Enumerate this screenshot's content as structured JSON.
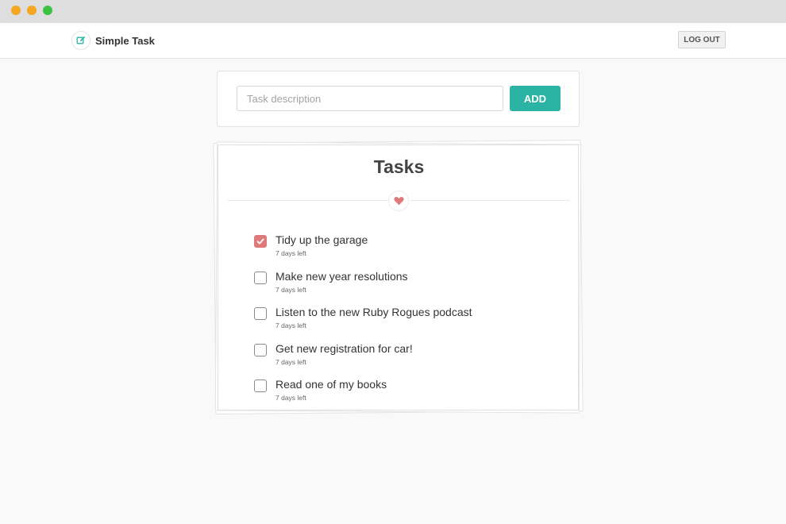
{
  "window": {
    "controls": [
      "close",
      "minimize",
      "maximize"
    ]
  },
  "navbar": {
    "brand_icon": "edit-pencil-icon",
    "brand_name": "Simple Task",
    "logout_label": "LOG OUT"
  },
  "add_form": {
    "placeholder": "Task description",
    "value": "",
    "add_label": "ADD"
  },
  "tasks_card": {
    "title": "Tasks",
    "divider_icon": "heart-icon"
  },
  "tasks": [
    {
      "label": "Tidy up the garage",
      "meta": "7 days left",
      "done": true
    },
    {
      "label": "Make new year resolutions",
      "meta": "7 days left",
      "done": false
    },
    {
      "label": "Listen to the new Ruby Rogues podcast",
      "meta": "7 days left",
      "done": false
    },
    {
      "label": "Get new registration for car!",
      "meta": "7 days left",
      "done": false
    },
    {
      "label": "Read one of my books",
      "meta": "7 days left",
      "done": false
    }
  ],
  "colors": {
    "accent": "#2bb3a4",
    "checked": "#e07a7a",
    "heart": "#e07a7a",
    "traffic_close": "#f5a623",
    "traffic_min": "#f5a623",
    "traffic_max": "#3cc240"
  }
}
